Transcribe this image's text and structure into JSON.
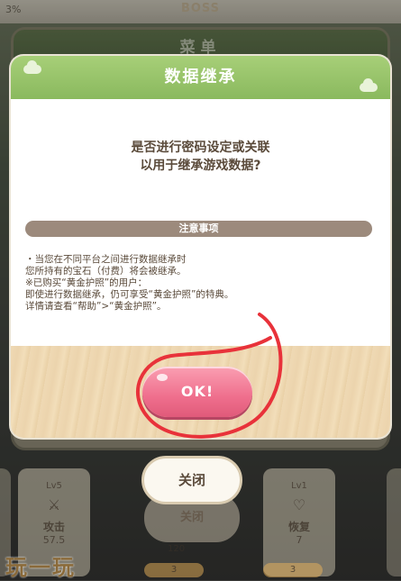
{
  "status": {
    "percent": "3%",
    "boss_label": "BOSS"
  },
  "menu": {
    "title": "菜单"
  },
  "dialog": {
    "title": "数据继承",
    "question_line1": "是否进行密码设定或关联",
    "question_line2": "以用于继承游戏数据?",
    "notice_title": "注意事项",
    "notes": [
      "・当您在不同平台之间进行数据继承时",
      "  您所持有的宝石（付费）将会被继承。",
      "※已购买“黄金护照”的用户：",
      "即使进行数据继承，仍可享受“黄金护照”的特典。",
      "详情请查看“帮助”>“黄金护照”。"
    ],
    "ok_label": "OK!"
  },
  "close_label": "关闭",
  "close_shadow_label": "关闭",
  "cards": [
    {
      "level": "Lv5",
      "name": "攻击",
      "value": "57.5",
      "cost": "3"
    },
    {
      "level": "Lv1",
      "name": "恢复",
      "value": "7",
      "cost": "3"
    }
  ],
  "bottom_mid_value": "120",
  "watermark": "玩一玩",
  "colors": {
    "header_green": "#8ab95e",
    "ok_pink": "#ef6f8d",
    "annotation_red": "#e8323a",
    "notice_brown": "#9c8a7c"
  }
}
